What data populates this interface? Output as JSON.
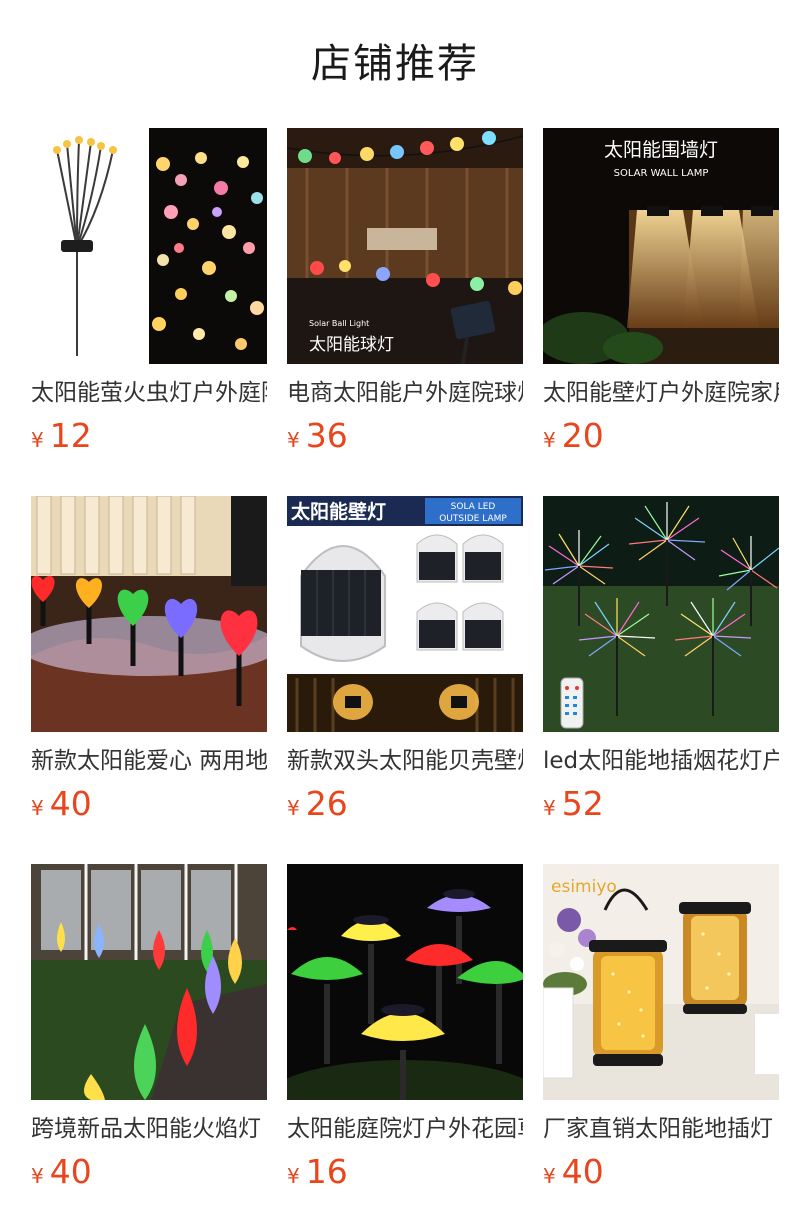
{
  "section": {
    "title": "店铺推荐"
  },
  "currency_symbol": "¥",
  "products": [
    {
      "name": "太阳能萤火虫灯户外庭院",
      "price": "12",
      "image_text": []
    },
    {
      "name": "电商太阳能户外庭院球灯",
      "price": "36",
      "image_text": [
        "Solar Ball Light",
        "太阳能球灯"
      ]
    },
    {
      "name": "太阳能壁灯户外庭院家用",
      "price": "20",
      "image_text": [
        "太阳能围墙灯",
        "SOLAR WALL LAMP"
      ]
    },
    {
      "name": "新款太阳能爱心 两用地插",
      "price": "40",
      "image_text": []
    },
    {
      "name": "新款双头太阳能贝壳壁灯",
      "price": "26",
      "image_text": [
        "太阳能壁灯",
        "SOLA LED",
        "OUTSIDE LAMP"
      ]
    },
    {
      "name": "led太阳能地插烟花灯户外",
      "price": "52",
      "image_text": []
    },
    {
      "name": "跨境新品太阳能火焰灯",
      "price": "40",
      "image_text": []
    },
    {
      "name": "太阳能庭院灯户外花园草坪",
      "price": "16",
      "image_text": []
    },
    {
      "name": "厂家直销太阳能地插灯",
      "price": "40",
      "image_text": [
        "esimiyo"
      ]
    }
  ],
  "colors": {
    "price": "#e8461c",
    "title": "#1a1a1a",
    "text": "#333333"
  }
}
